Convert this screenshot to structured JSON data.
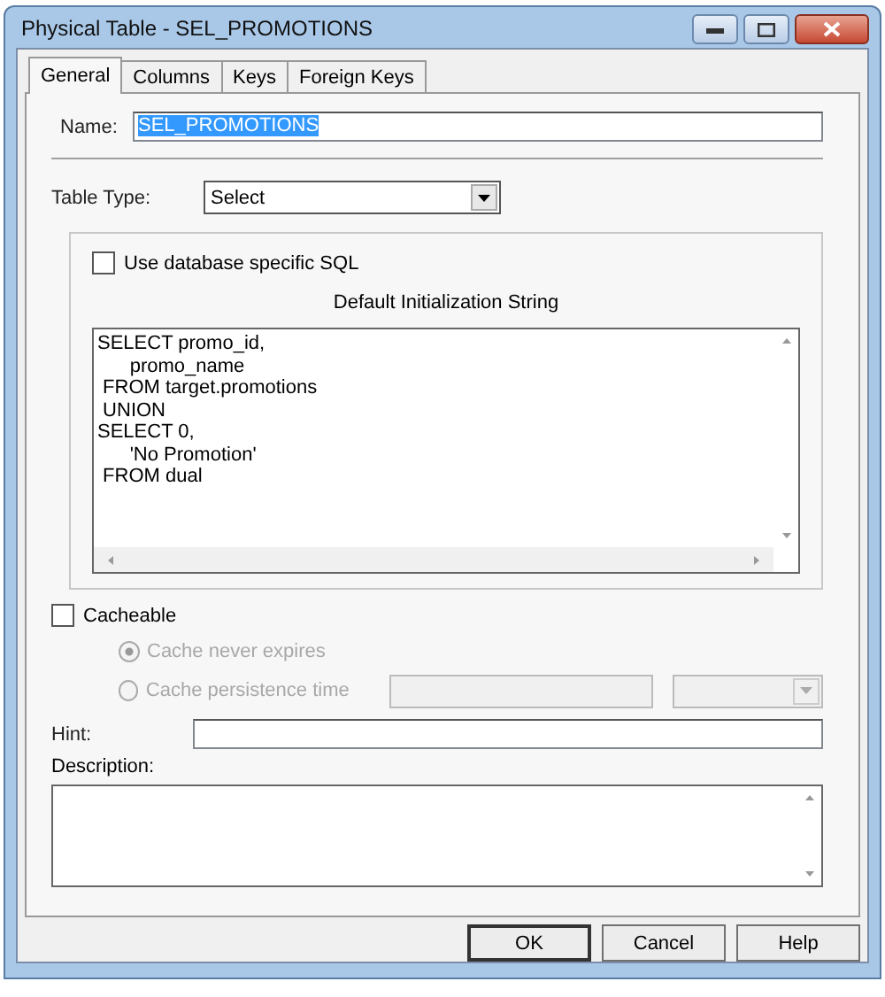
{
  "window": {
    "title": "Physical Table - SEL_PROMOTIONS"
  },
  "tabs": [
    {
      "label": "General",
      "selected": true
    },
    {
      "label": "Columns",
      "selected": false
    },
    {
      "label": "Keys",
      "selected": false
    },
    {
      "label": "Foreign Keys",
      "selected": false
    }
  ],
  "name": {
    "label": "Name:",
    "value": "SEL_PROMOTIONS",
    "highlighted": true
  },
  "table_type": {
    "label": "Table Type:",
    "value": "Select"
  },
  "use_database_sql": {
    "label": "Use database specific SQL",
    "checked": false
  },
  "init_string": {
    "label": "Default Initialization String",
    "lines": [
      "SELECT promo_id,",
      "      promo_name",
      " FROM target.promotions",
      " UNION",
      "SELECT 0,",
      "      'No Promotion'",
      " FROM dual"
    ]
  },
  "cacheable": {
    "label": "Cacheable",
    "checked": false
  },
  "cache_options": [
    {
      "label": "Cache never expires",
      "selected": true,
      "disabled": true
    },
    {
      "label": "Cache persistence time",
      "selected": false,
      "disabled": true
    }
  ],
  "hint": {
    "label": "Hint:"
  },
  "description": {
    "label": "Description:"
  },
  "buttons": [
    {
      "label": "OK",
      "default": true
    },
    {
      "label": "Cancel",
      "default": false
    },
    {
      "label": "Help",
      "default": false
    }
  ]
}
